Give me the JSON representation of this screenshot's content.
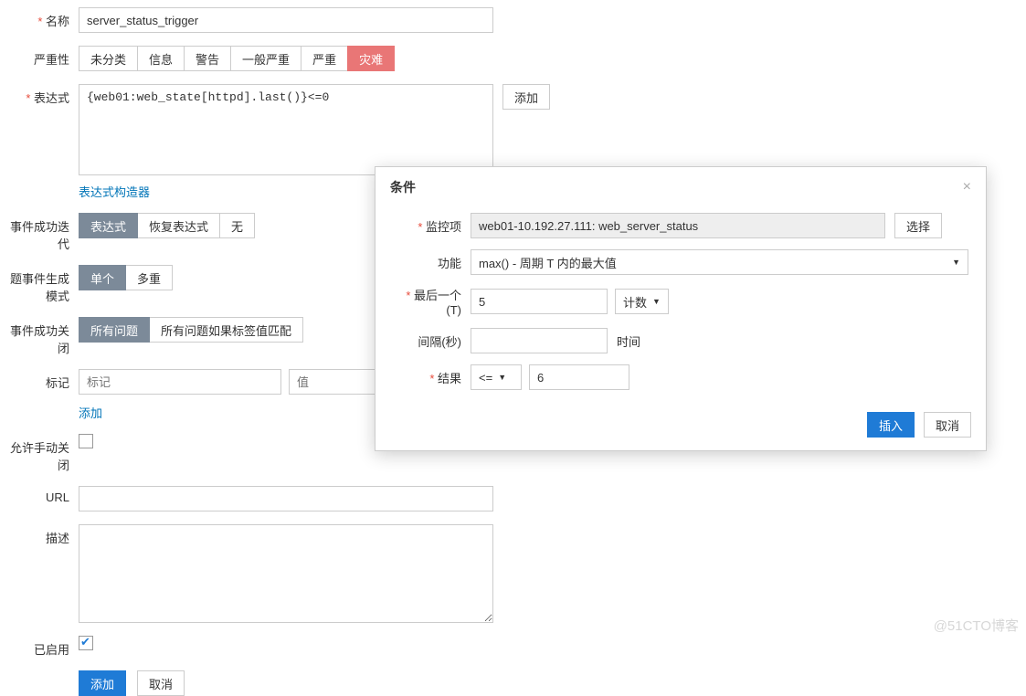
{
  "form": {
    "name_label": "名称",
    "name_value": "server_status_trigger",
    "severity_label": "严重性",
    "severity_options": [
      "未分类",
      "信息",
      "警告",
      "一般严重",
      "严重",
      "灾难"
    ],
    "expression_label": "表达式",
    "expression_value": "{web01:web_state[httpd].last()}<=0",
    "expression_add_btn": "添加",
    "expression_builder_link": "表达式构造器",
    "ok_event_gen_label": "事件成功迭代",
    "ok_event_gen_options": [
      "表达式",
      "恢复表达式",
      "无"
    ],
    "problem_mode_label": "题事件生成模式",
    "problem_mode_options": [
      "单个",
      "多重"
    ],
    "ok_event_close_label": "事件成功关闭",
    "ok_event_close_options": [
      "所有问题",
      "所有问题如果标签值匹配"
    ],
    "tags_label": "标记",
    "tag_placeholder": "标记",
    "value_placeholder": "值",
    "tags_add_link": "添加",
    "manual_close_label": "允许手动关闭",
    "url_label": "URL",
    "url_value": "",
    "desc_label": "描述",
    "desc_value": "",
    "enabled_label": "已启用",
    "submit_btn": "添加",
    "cancel_btn": "取消"
  },
  "modal": {
    "title": "条件",
    "item_label": "监控项",
    "item_value": "web01-10.192.27.111: web_server_status",
    "select_btn": "选择",
    "function_label": "功能",
    "function_value": "max() - 周期 T 内的最大值",
    "last_label": "最后一个 (T)",
    "last_value": "5",
    "last_unit": "计数",
    "interval_label": "间隔(秒)",
    "interval_value": "",
    "interval_unit": "时间",
    "result_label": "结果",
    "result_op": "<=",
    "result_value": "6",
    "insert_btn": "插入",
    "cancel_btn": "取消"
  },
  "watermark": "@51CTO博客"
}
